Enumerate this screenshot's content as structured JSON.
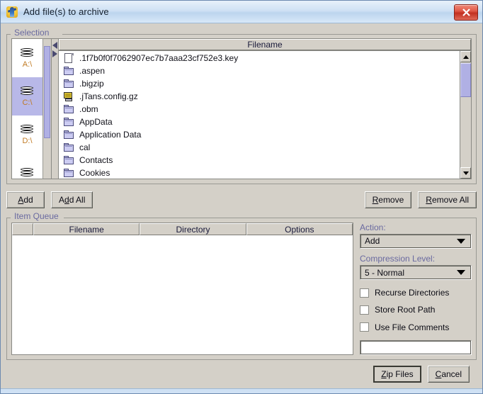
{
  "window": {
    "title": "Add file(s) to archive",
    "icon": "app-icon",
    "close_label": "×"
  },
  "selection": {
    "legend": "Selection",
    "drives": [
      {
        "label": "A:\\",
        "selected": false
      },
      {
        "label": "C:\\",
        "selected": true
      },
      {
        "label": "D:\\",
        "selected": false
      },
      {
        "label": "",
        "selected": false
      }
    ],
    "file_header": "Filename",
    "files": [
      {
        "name": ".1f7b0f0f7062907ec7b7aaa23cf752e3.key",
        "icon": "document-icon"
      },
      {
        "name": ".aspen",
        "icon": "folder-icon"
      },
      {
        "name": ".bigzip",
        "icon": "folder-icon"
      },
      {
        "name": ".jTans.config.gz",
        "icon": "archive-icon"
      },
      {
        "name": ".obm",
        "icon": "folder-icon"
      },
      {
        "name": "AppData",
        "icon": "folder-icon"
      },
      {
        "name": "Application Data",
        "icon": "folder-icon"
      },
      {
        "name": "cal",
        "icon": "folder-icon"
      },
      {
        "name": "Contacts",
        "icon": "folder-icon"
      },
      {
        "name": "Cookies",
        "icon": "folder-icon"
      }
    ]
  },
  "actions": {
    "add": "Add",
    "add_all": "Add All",
    "remove": "Remove",
    "remove_all": "Remove All"
  },
  "queue": {
    "legend": "Item Queue",
    "columns": [
      "",
      "Filename",
      "Directory",
      "Options"
    ],
    "rows": []
  },
  "options": {
    "action_label": "Action:",
    "action_value": "Add",
    "compression_label": "Compression Level:",
    "compression_value": "5 - Normal",
    "checkboxes": [
      {
        "label": "Recurse Directories",
        "checked": false
      },
      {
        "label": "Store Root Path",
        "checked": false
      },
      {
        "label": "Use File Comments",
        "checked": false
      }
    ],
    "comment_value": ""
  },
  "footer": {
    "zip_files": "Zip Files",
    "cancel": "Cancel"
  },
  "colors": {
    "titlebar": "#cfe1f4",
    "face": "#d4d0c8",
    "legend_text": "#6a6aa0",
    "drive_label": "#c07a22",
    "selection_highlight": "#b8b8e8",
    "close_button": "#c23020"
  }
}
